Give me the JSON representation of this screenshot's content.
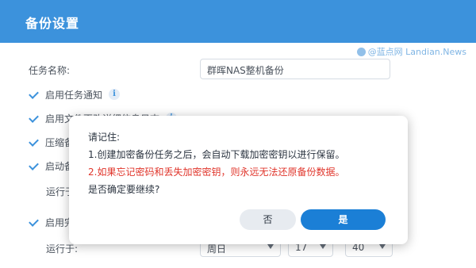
{
  "header": {
    "title": "备份设置"
  },
  "watermark": {
    "text": "@蓝点网 Landian.News"
  },
  "form": {
    "task_name_label": "任务名称:",
    "task_name_value": "群晖NAS整机备份",
    "checkboxes": [
      {
        "label": "启用任务通知",
        "checked": true,
        "info": true
      },
      {
        "label": "启用文件更改详细信息日志",
        "checked": true,
        "info": true
      },
      {
        "label": "压缩备份数据",
        "checked": true
      },
      {
        "label": "启动备份计划",
        "checked": true
      },
      {
        "label": "启用完整性检查",
        "checked": true
      }
    ],
    "run_at_label_1": "运行于:",
    "run_at_label_2": "运行于:",
    "schedule": {
      "day": "周日",
      "hour": "17",
      "minute": "40"
    }
  },
  "dialog": {
    "title": "请记住:",
    "line1": "1.创建加密备份任务之后，会自动下载加密密钥以进行保留。",
    "line2": "2.如果忘记密码和丢失加密密钥，则永远无法还原备份数据。",
    "question": "是否确定要继续?",
    "no_label": "否",
    "yes_label": "是"
  },
  "colors": {
    "accent": "#1b7fd6",
    "warning": "#e0352b"
  }
}
